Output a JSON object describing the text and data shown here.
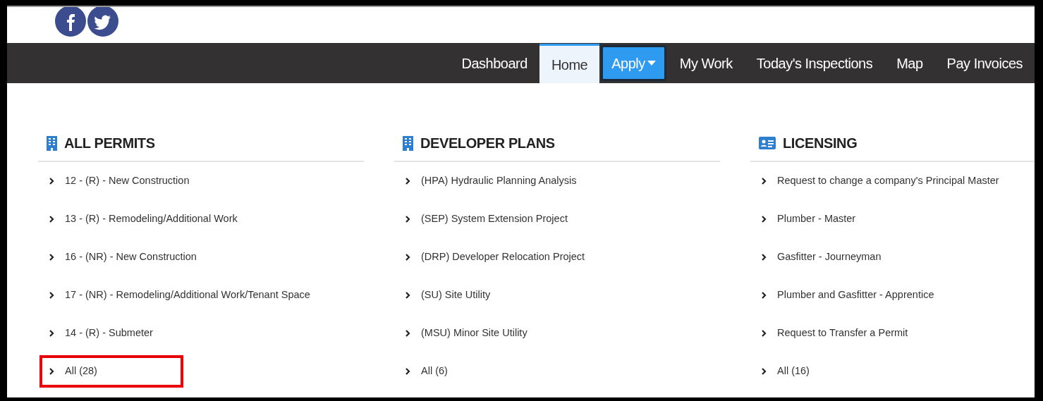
{
  "nav": {
    "items": [
      {
        "label": "Dashboard",
        "kind": "link",
        "selected": false
      },
      {
        "label": "Home",
        "kind": "link",
        "selected": true
      },
      {
        "label": "Apply",
        "kind": "dropdown",
        "selected": false
      },
      {
        "label": "My Work",
        "kind": "link",
        "selected": false
      },
      {
        "label": "Today's Inspections",
        "kind": "link",
        "selected": false
      },
      {
        "label": "Map",
        "kind": "link",
        "selected": false
      },
      {
        "label": "Pay Invoices",
        "kind": "link",
        "selected": false
      }
    ]
  },
  "sections": [
    {
      "title": "ALL PERMITS",
      "kind": "building",
      "items": [
        {
          "label": "12 - (R) - New Construction",
          "highlighted": false
        },
        {
          "label": "13 - (R) - Remodeling/Additional Work",
          "highlighted": false
        },
        {
          "label": "16 - (NR) - New Construction",
          "highlighted": false
        },
        {
          "label": "17 - (NR) - Remodeling/Additional Work/Tenant Space",
          "highlighted": false
        },
        {
          "label": "14 - (R) - Submeter",
          "highlighted": false
        },
        {
          "label": "All (28)",
          "highlighted": true
        }
      ]
    },
    {
      "title": "DEVELOPER PLANS",
      "kind": "building",
      "items": [
        {
          "label": "(HPA) Hydraulic Planning Analysis",
          "highlighted": false
        },
        {
          "label": "(SEP) System Extension Project",
          "highlighted": false
        },
        {
          "label": "(DRP) Developer Relocation Project",
          "highlighted": false
        },
        {
          "label": "(SU) Site Utility",
          "highlighted": false
        },
        {
          "label": "(MSU) Minor Site Utility",
          "highlighted": false
        },
        {
          "label": "All (6)",
          "highlighted": false
        }
      ]
    },
    {
      "title": "LICENSING",
      "kind": "card",
      "items": [
        {
          "label": "Request to change a company's Principal Master",
          "highlighted": false
        },
        {
          "label": "Plumber - Master",
          "highlighted": false
        },
        {
          "label": "Gasfitter - Journeyman",
          "highlighted": false
        },
        {
          "label": "Plumber and Gasfitter - Apprentice",
          "highlighted": false
        },
        {
          "label": "Request to Transfer a Permit",
          "highlighted": false
        },
        {
          "label": "All (16)",
          "highlighted": false
        }
      ]
    }
  ]
}
